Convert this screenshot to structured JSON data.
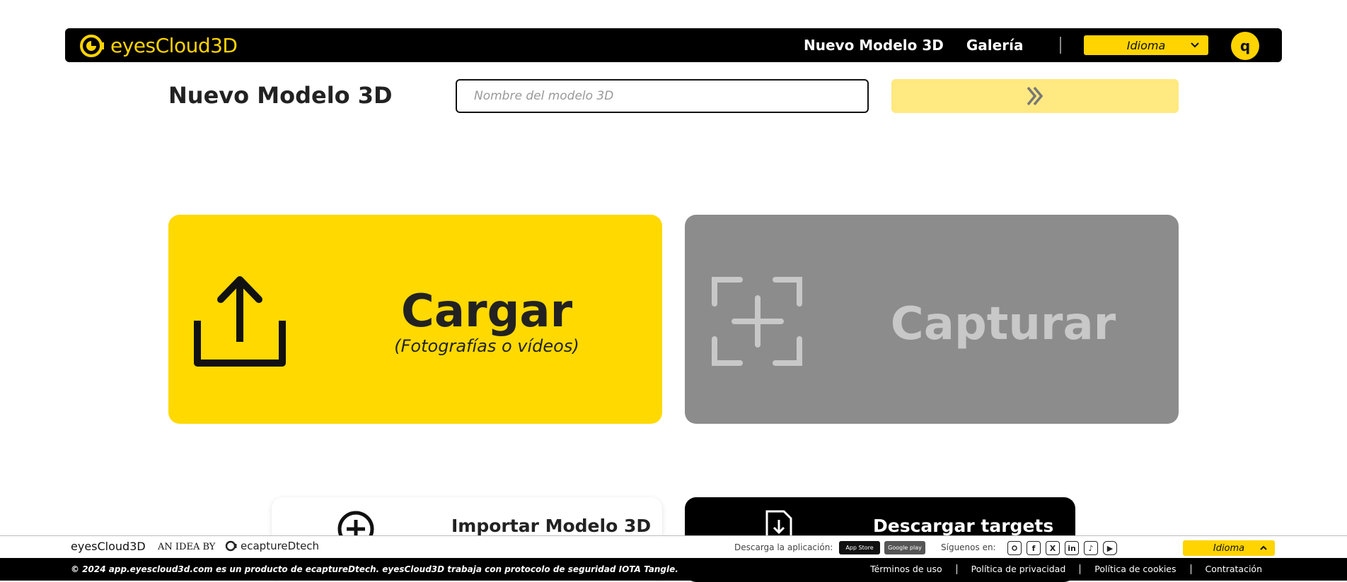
{
  "brand": {
    "name": "eyesCloud3D"
  },
  "nav": {
    "links": [
      "Nuevo Modelo 3D",
      "Galería"
    ],
    "language_label": "Idioma",
    "user_initial": "q"
  },
  "header": {
    "title": "Nuevo Modelo 3D",
    "model_name_placeholder": "Nombre del modelo 3D",
    "model_name_value": ""
  },
  "cards": {
    "upload": {
      "title": "Cargar",
      "subtitle": "(Fotografías o vídeos)",
      "icon": "upload-icon"
    },
    "capture": {
      "title": "Capturar",
      "icon": "capture-frame-plus-icon",
      "state": "disabled"
    },
    "import": {
      "label": "Importar Modelo 3D",
      "icon": "plus-circle-icon"
    },
    "targets": {
      "label": "Descargar targets",
      "icon": "file-download-icon"
    }
  },
  "footer": {
    "brand": "eyesCloud3D",
    "idea_by": "AN IDEA BY",
    "partner": "ecaptureDtech",
    "download_label": "Descarga la aplicación:",
    "app_store": "App Store",
    "google_play": "Google play",
    "follow_label": "Síguenos en:",
    "social": [
      "instagram-icon",
      "facebook-icon",
      "x-icon",
      "linkedin-icon",
      "tiktok-icon",
      "youtube-icon"
    ],
    "language_label": "Idioma",
    "copyright": "© 2024 app.eyescloud3d.com es un producto de ecaptureDtech. eyesCloud3D trabaja con protocolo de seguridad IOTA Tangle.",
    "legal_links": [
      "Términos de uso",
      "Política de privacidad",
      "Política de cookies",
      "Contratación"
    ]
  },
  "colors": {
    "accent": "#ffd900",
    "accent_light": "#ffe980",
    "disabled": "#8c8c8c",
    "nav_bg": "#000000"
  }
}
